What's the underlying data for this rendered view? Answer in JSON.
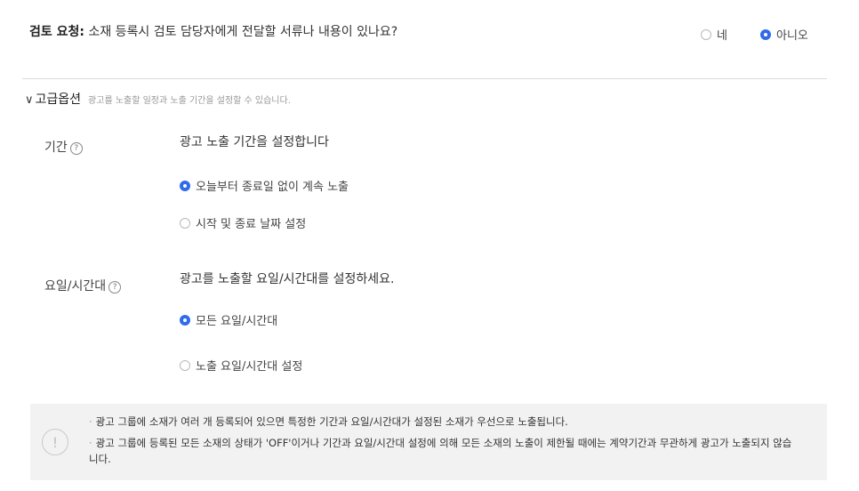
{
  "review": {
    "label": "검토 요청:",
    "question": "소재 등록시 검토 담당자에게 전달할 서류나 내용이 있나요?",
    "options": [
      {
        "label": "네",
        "selected": false
      },
      {
        "label": "아니오",
        "selected": true
      }
    ]
  },
  "advanced": {
    "chevron": "∨",
    "title": "고급옵션",
    "description": "광고를 노출할 일정과 노출 기간을 설정할 수 있습니다."
  },
  "period": {
    "label": "기간",
    "help": "?",
    "heading": "광고 노출 기간을 설정합니다",
    "options": [
      {
        "label": "오늘부터 종료일 없이 계속 노출",
        "selected": true
      },
      {
        "label": "시작 및 종료 날짜 설정",
        "selected": false
      }
    ]
  },
  "schedule": {
    "label": "요일/시간대",
    "help": "?",
    "heading": "광고를 노출할 요일/시간대를 설정하세요.",
    "options": [
      {
        "label": "모든 요일/시간대",
        "selected": true
      },
      {
        "label": "노출 요일/시간대 설정",
        "selected": false
      }
    ]
  },
  "notice": {
    "icon": "!",
    "bullet": "·",
    "lines": [
      "광고 그룹에 소재가 여러 개 등록되어 있으면 특정한 기간과 요일/시간대가 설정된 소재가 우선으로 노출됩니다.",
      "광고 그룹에 등록된 모든 소재의 상태가 'OFF'이거나 기간과 요일/시간대 설정에 의해 모든 소재의 노출이 제한될 때에는 계약기간과 무관하게 광고가 노출되지 않습니다."
    ]
  },
  "colors": {
    "accent": "#2f6bea",
    "notice_bg": "#f2f2f2"
  }
}
